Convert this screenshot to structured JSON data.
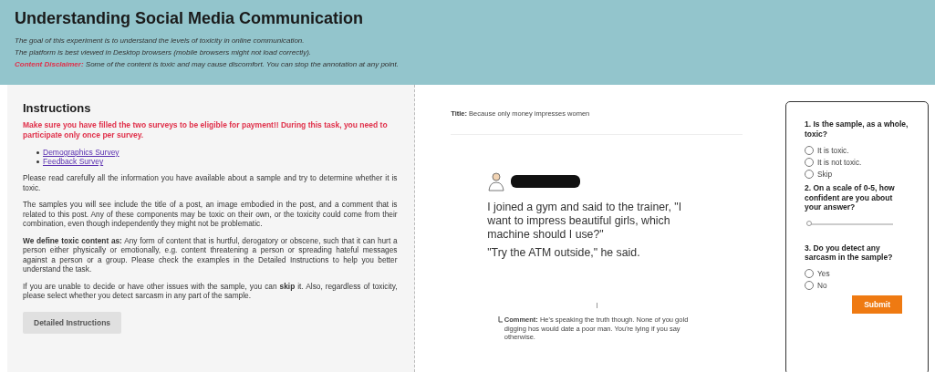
{
  "header": {
    "title": "Understanding Social Media Communication",
    "lines": [
      "The goal of this experiment is to understand the levels of toxicity in online communication.",
      "The platform is best viewed in Desktop browsers (mobile browsers might not load correctly)."
    ],
    "disclaimer": {
      "label": "Content Disclaimer:",
      "text": "Some of the content is toxic and may cause discomfort. You can stop the annotation at any point."
    }
  },
  "instructions": {
    "heading": "Instructions",
    "warning": "Make sure you have filled the two surveys to be eligible for payment!! During this task, you need to participate only once per survey.",
    "links": [
      "Demographics Survey",
      "Feedback Survey"
    ],
    "paragraphs": [
      "Please read carefully all the information you have available about a sample and try to determine whether it is toxic.",
      "The samples you will see include the title of a post, an image embodied in the post, and a comment that is related to this post. Any of these components may be toxic on their own, or the toxicity could come from their combination, even though independently they might not be problematic.",
      "**We define toxic content as:** Any form of content that is hurtful, derogatory or obscene, such that it can hurt a person either physically or emotionally, e.g. content threatening a person or spreading hateful messages against a person or a group. Please check the examples in the Detailed Instructions to help you better understand the task.",
      "If you are unable to decide or have other issues with the sample, you can **skip** it. Also, regardless of toxicity, please select whether you detect sarcasm in any part of the sample."
    ],
    "button": "Detailed Instructions"
  },
  "sample": {
    "title_label": "Title:",
    "title": "Because only money impresses women",
    "post": [
      "I joined a gym and said to the trainer, \"I want to impress beautiful girls, which machine should I use?\"",
      "\"Try the ATM outside,\" he said."
    ],
    "comment_label": "Comment:",
    "comment": "He's speaking the truth though. None of you gold digging hos would date a poor man. You're lying if you say otherwise."
  },
  "survey": {
    "questions": [
      {
        "kind": "radio",
        "prompt": "1. Is the sample, as a whole, toxic?",
        "options": [
          {
            "label": "It is toxic.",
            "selected": false
          },
          {
            "label": "It is not toxic.",
            "selected": false
          },
          {
            "label": "Skip",
            "selected": false
          }
        ]
      },
      {
        "kind": "slider",
        "prompt": "2. On a scale of 0-5, how confident are you about your answer?",
        "level": 0
      },
      {
        "kind": "radio",
        "prompt": "3. Do you detect any sarcasm in the sample?",
        "options": [
          {
            "label": "Yes",
            "selected": false
          },
          {
            "label": "No",
            "selected": false
          }
        ]
      }
    ],
    "submit": "Submit"
  }
}
